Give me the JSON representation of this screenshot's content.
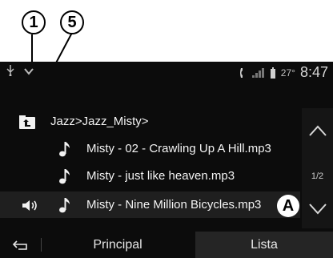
{
  "callouts": [
    "1",
    "5"
  ],
  "status": {
    "time": "8:47",
    "temp": "27°"
  },
  "folder": {
    "path": "Jazz>Jazz_Misty>"
  },
  "tracks": [
    {
      "name": "Misty - 02 - Crawling Up A Hill.mp3",
      "playing": false
    },
    {
      "name": "Misty - just like heaven.mp3",
      "playing": false
    },
    {
      "name": "Misty - Nine Million Bicycles.mp3",
      "playing": true
    }
  ],
  "marker": "A",
  "pager": {
    "page": "1/2"
  },
  "bottom": {
    "principal_label": "Principal",
    "lista_label": "Lista"
  },
  "icons": {
    "status_left": "usb-icon",
    "dropdown": "chevron-down-icon",
    "phone": "phone-icon",
    "signal": "signal-icon",
    "battery": "battery-icon",
    "folder_up": "folder-up-icon",
    "note": "music-note-icon",
    "volume": "volume-icon",
    "scroll_up": "chevron-up-icon",
    "scroll_down": "chevron-down-icon",
    "back": "back-icon"
  }
}
